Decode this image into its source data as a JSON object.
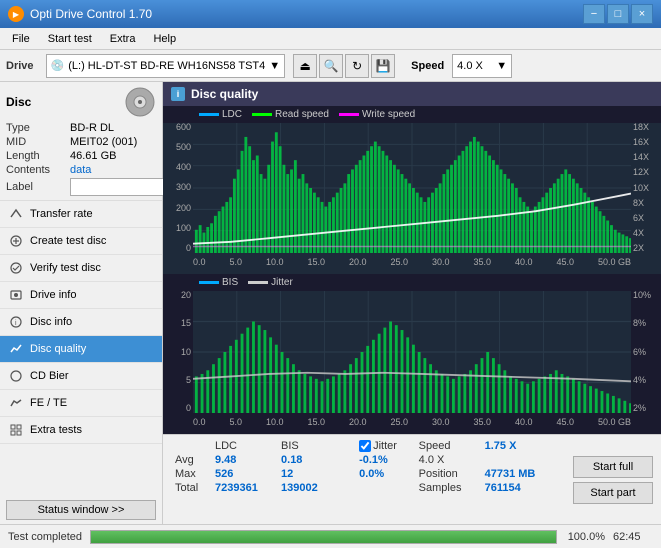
{
  "app": {
    "title": "Opti Drive Control 1.70",
    "icon": "disc-icon"
  },
  "title_buttons": {
    "minimize": "−",
    "maximize": "□",
    "close": "×"
  },
  "menu": {
    "items": [
      "File",
      "Start test",
      "Extra",
      "Help"
    ]
  },
  "drive_bar": {
    "label": "Drive",
    "drive_name": "(L:)  HL-DT-ST BD-RE  WH16NS58 TST4",
    "speed_label": "Speed",
    "speed_value": "4.0 X",
    "icons": [
      "eject-icon",
      "info-icon",
      "refresh-icon",
      "save-icon"
    ]
  },
  "disc_panel": {
    "title": "Disc",
    "rows": [
      {
        "key": "Type",
        "value": "BD-R DL",
        "blue": false
      },
      {
        "key": "MID",
        "value": "MEIT02 (001)",
        "blue": false
      },
      {
        "key": "Length",
        "value": "46.61 GB",
        "blue": false
      },
      {
        "key": "Contents",
        "value": "data",
        "blue": true
      }
    ],
    "label_placeholder": ""
  },
  "nav_items": [
    {
      "id": "transfer-rate",
      "label": "Transfer rate",
      "active": false
    },
    {
      "id": "create-test-disc",
      "label": "Create test disc",
      "active": false
    },
    {
      "id": "verify-test-disc",
      "label": "Verify test disc",
      "active": false
    },
    {
      "id": "drive-info",
      "label": "Drive info",
      "active": false
    },
    {
      "id": "disc-info",
      "label": "Disc info",
      "active": false
    },
    {
      "id": "disc-quality",
      "label": "Disc quality",
      "active": true
    },
    {
      "id": "cd-bier",
      "label": "CD Bier",
      "active": false
    },
    {
      "id": "fe-te",
      "label": "FE / TE",
      "active": false
    },
    {
      "id": "extra-tests",
      "label": "Extra tests",
      "active": false
    }
  ],
  "status_btn": "Status window >>",
  "disc_quality": {
    "title": "Disc quality",
    "legend_top": [
      {
        "key": "ldc",
        "label": "LDC"
      },
      {
        "key": "read",
        "label": "Read speed"
      },
      {
        "key": "write",
        "label": "Write speed"
      }
    ],
    "legend_bottom": [
      {
        "key": "bis",
        "label": "BIS"
      },
      {
        "key": "jitter",
        "label": "Jitter"
      }
    ],
    "y_axis_top": [
      "600",
      "500",
      "400",
      "300",
      "200",
      "100",
      "0"
    ],
    "y_axis_top_right": [
      "18X",
      "16X",
      "14X",
      "12X",
      "10X",
      "8X",
      "6X",
      "4X",
      "2X"
    ],
    "y_axis_bottom": [
      "20",
      "15",
      "10",
      "5",
      "0"
    ],
    "y_axis_bottom_right": [
      "10%",
      "8%",
      "6%",
      "4%",
      "2%"
    ],
    "x_axis": [
      "0.0",
      "5.0",
      "10.0",
      "15.0",
      "20.0",
      "25.0",
      "30.0",
      "35.0",
      "40.0",
      "45.0",
      "50.0 GB"
    ]
  },
  "stats": {
    "headers": [
      "",
      "LDC",
      "BIS",
      "",
      "Jitter",
      "Speed",
      ""
    ],
    "avg": {
      "ldc": "9.48",
      "bis": "0.18",
      "jitter": "-0.1%",
      "speed_label": "1.75 X"
    },
    "max": {
      "ldc": "526",
      "bis": "12",
      "jitter": "0.0%",
      "position_label": "Position",
      "position_val": "47731 MB"
    },
    "total": {
      "ldc": "7239361",
      "bis": "139002",
      "samples_label": "Samples",
      "samples_val": "761154"
    },
    "speed_label": "Speed",
    "speed_val": "4.0 X",
    "jitter_checked": true,
    "jitter_label": "Jitter"
  },
  "actions": {
    "start_full": "Start full",
    "start_part": "Start part"
  },
  "progress": {
    "status": "Test completed",
    "percent": "100.0%",
    "percent_num": 100,
    "time": "62:45"
  }
}
